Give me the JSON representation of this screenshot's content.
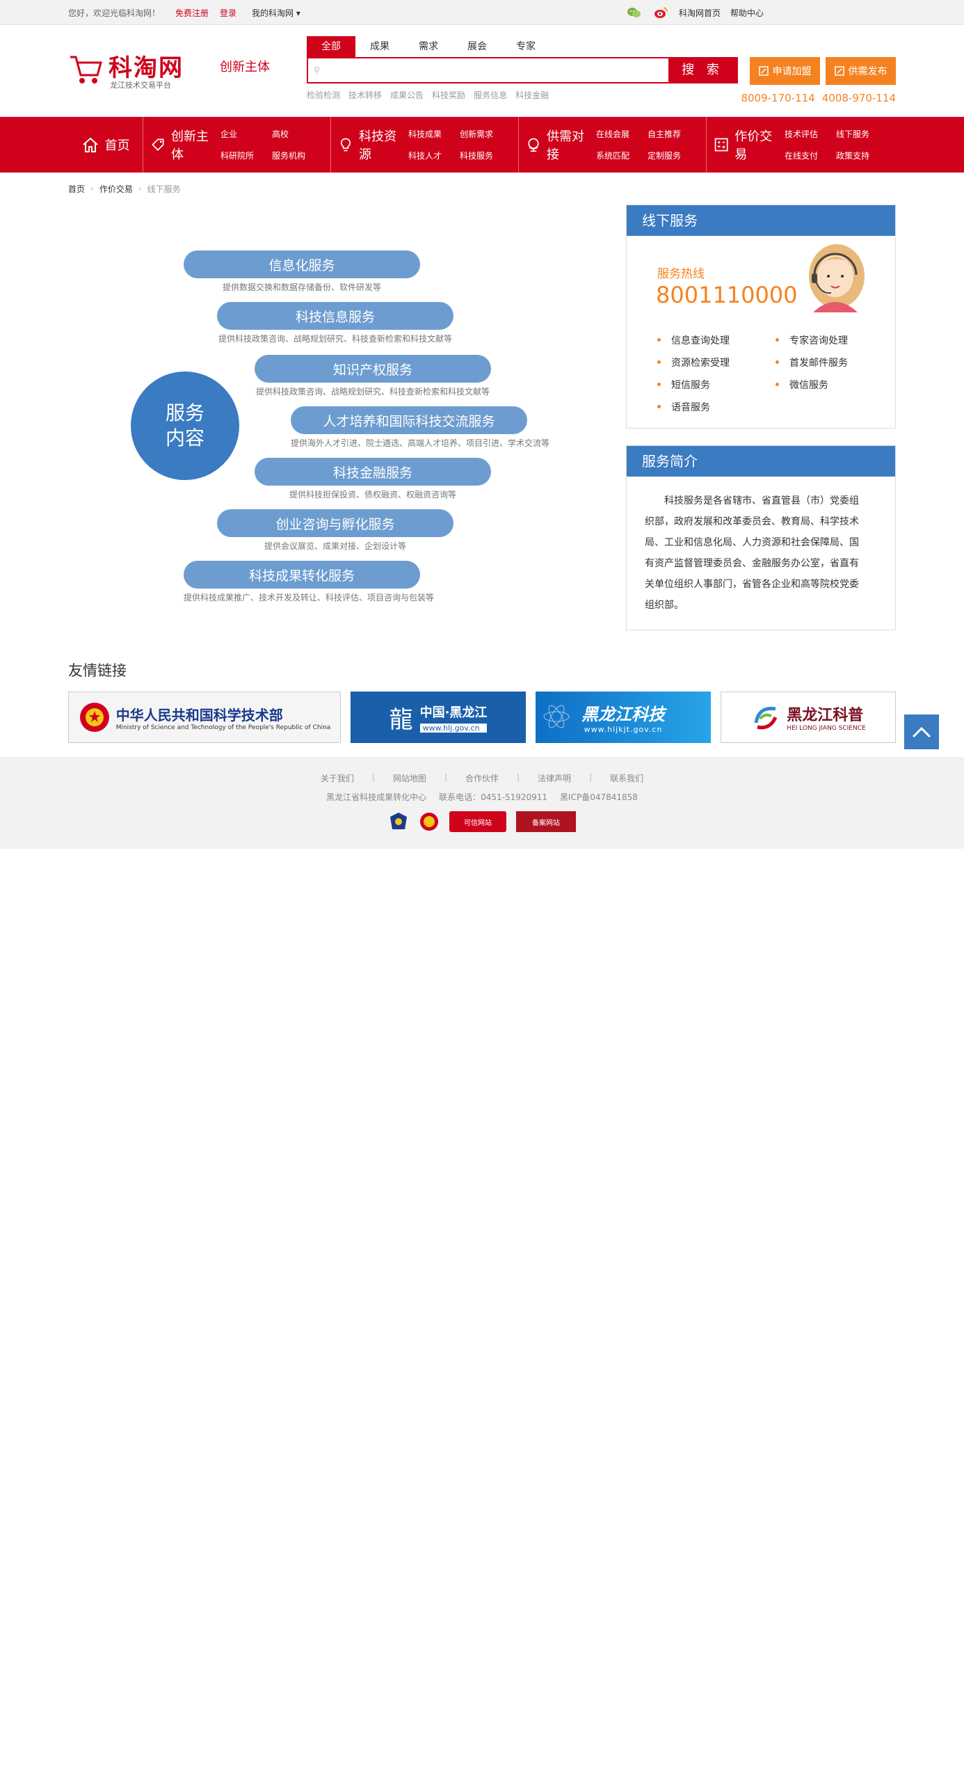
{
  "topbar": {
    "welcome": "您好，欢迎光临科淘网！",
    "register": "免费注册",
    "login": "登录",
    "my_account": "我的科淘网",
    "home_link": "科淘网首页",
    "help": "帮助中心"
  },
  "header": {
    "logo_name": "科淘网",
    "logo_sub": "龙江技术交易平台",
    "logo_tag": "创新主体",
    "search_tabs": [
      "全部",
      "成果",
      "需求",
      "展会",
      "专家"
    ],
    "search_placeholder": "",
    "search_button": "搜 索",
    "hot_words": [
      "检验检测",
      "技术转移",
      "成果公告",
      "科技奖励",
      "服务信息",
      "科技金融"
    ],
    "apply_button": "申请加盟",
    "publish_button": "供需发布",
    "phone1": "8009-170-114",
    "phone2": "4008-970-114"
  },
  "nav": {
    "home": "首页",
    "groups": [
      {
        "title": "创新主体",
        "links": [
          "企业",
          "高校",
          "科研院所",
          "服务机构"
        ]
      },
      {
        "title": "科技资源",
        "links": [
          "科技成果",
          "创新需求",
          "科技人才",
          "科技服务"
        ]
      },
      {
        "title": "供需对接",
        "links": [
          "在线会展",
          "自主推荐",
          "系统匹配",
          "定制服务"
        ]
      },
      {
        "title": "作价交易",
        "links": [
          "技术评估",
          "线下服务",
          "在线支付",
          "政策支持"
        ]
      }
    ]
  },
  "breadcrumb": {
    "home": "首页",
    "parent": "作价交易",
    "current": "线下服务"
  },
  "services": {
    "center_label_line1": "服务",
    "center_label_line2": "内容",
    "items": [
      {
        "title": "信息化服务",
        "desc": "提供数据交换和数据存储备份、软件研发等"
      },
      {
        "title": "科技信息服务",
        "desc": "提供科技政策咨询、战略规划研究、科技查新检索和科技文献等"
      },
      {
        "title": "知识产权服务",
        "desc": "提供科技政策咨询、战略规划研究、科技查新检索和科技文献等"
      },
      {
        "title": "人才培养和国际科技交流服务",
        "desc": "提供海外人才引进、院士遴选、高端人才培养、项目引进、学术交流等"
      },
      {
        "title": "科技金融服务",
        "desc": "提供科技担保投资、债权融资、权融资咨询等"
      },
      {
        "title": "创业咨询与孵化服务",
        "desc": "提供会议展览、成果对接、企划设计等"
      },
      {
        "title": "科技成果转化服务",
        "desc": "提供科技成果推广、技术开发及转让、科技评估、项目咨询与包装等"
      }
    ]
  },
  "offline": {
    "title": "线下服务",
    "hotline_label": "服务热线",
    "hotline_number": "8001110000",
    "items": [
      "信息查询处理",
      "专家咨询处理",
      "资源检索受理",
      "首发邮件服务",
      "短信服务",
      "微信服务",
      "语音服务"
    ]
  },
  "intro": {
    "title": "服务简介",
    "text": "科技服务是各省辖市、省直管县（市）党委组织部，政府发展和改革委员会、教育局、科学技术局、工业和信息化局、人力资源和社会保障局、国有资产监督管理委员会、金融服务办公室，省直有关单位组织人事部门，省管各企业和高等院校党委组织部。"
  },
  "friend_links": {
    "title": "友情链接",
    "items": [
      {
        "name": "中华人民共和国科学技术部",
        "sub": "Ministry of Science and Technology of the People's Republic of China"
      },
      {
        "name": "中国·黑龙江",
        "sub": "www.hlj.gov.cn"
      },
      {
        "name": "黑龙江科技",
        "sub": "www.hljkjt.gov.cn"
      },
      {
        "name": "黑龙江科普",
        "sub": "HEI LONG JIANG SCIENCE"
      }
    ]
  },
  "footer": {
    "links": [
      "关于我们",
      "网站地图",
      "合作伙伴",
      "法律声明",
      "联系我们"
    ],
    "org": "黑龙江省科技成果转化中心",
    "phone": "联系电话：0451-51920911",
    "icp": "黑ICP备047841858",
    "badges": [
      "可信网站",
      "备案网站"
    ]
  },
  "colors": {
    "brand_red": "#d0021b",
    "accent_orange": "#f58220",
    "service_blue": "#3a7bc1",
    "pill_blue": "#6d9dd0"
  }
}
